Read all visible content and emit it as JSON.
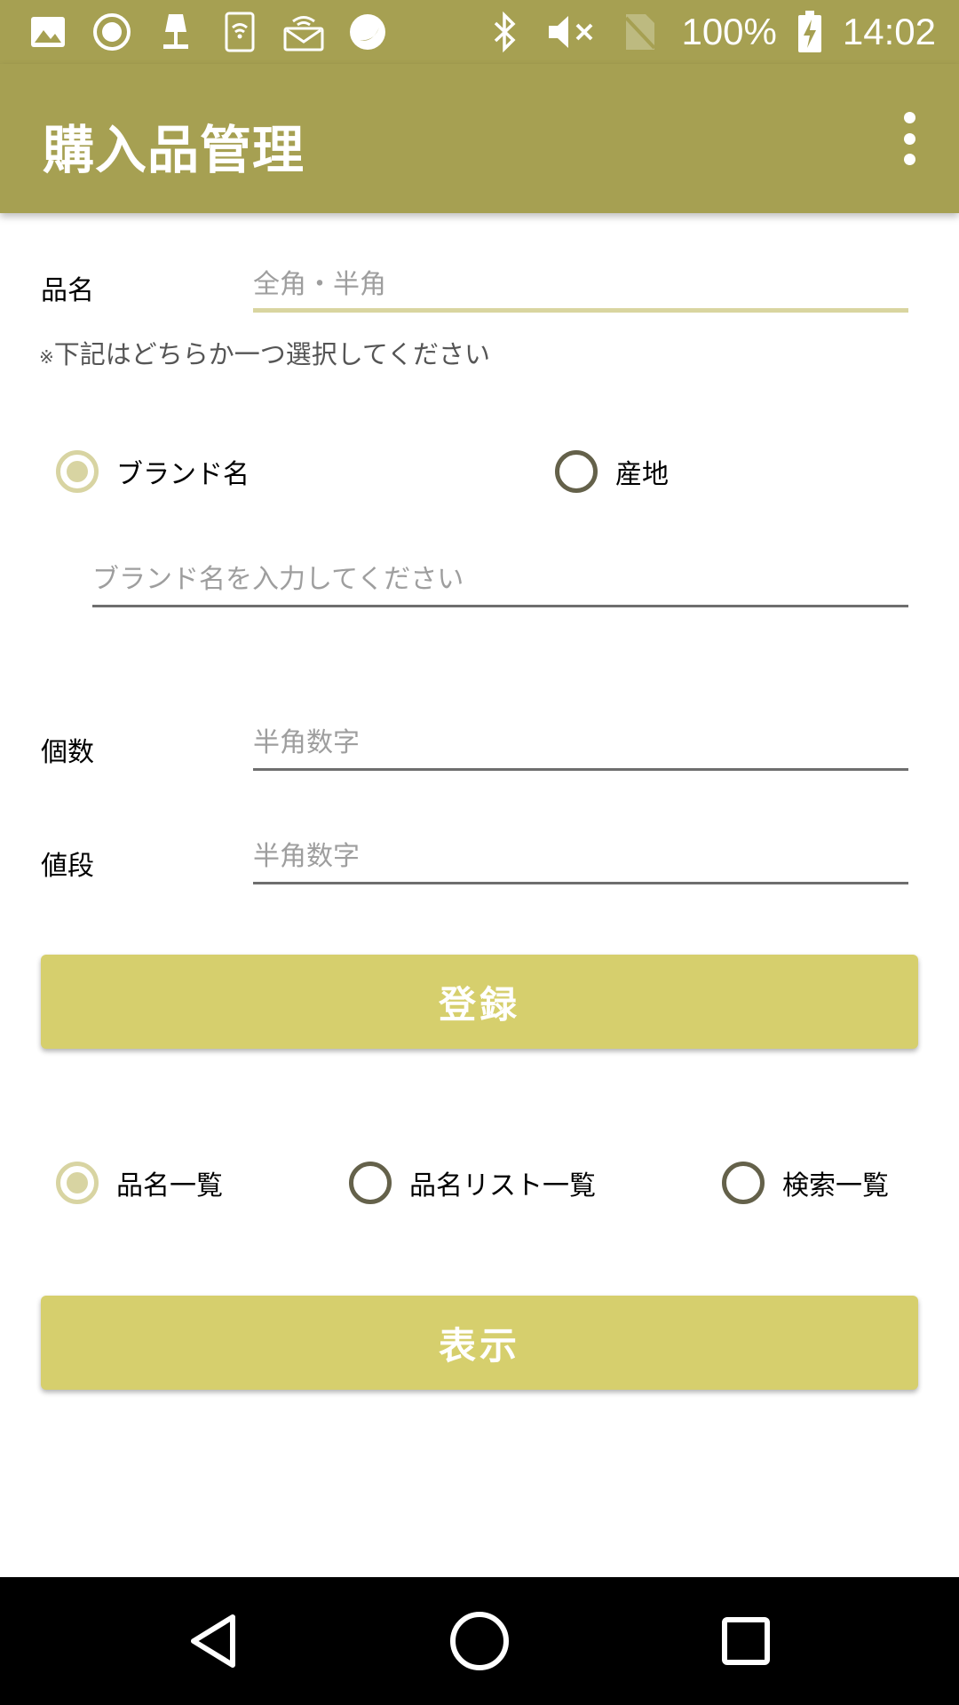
{
  "status_bar": {
    "battery": "100%",
    "time": "14:02",
    "icons": [
      "image-icon",
      "record-icon",
      "lamp-icon",
      "sim-wifi-icon",
      "router-icon",
      "moon-icon",
      "bluetooth-icon",
      "mute-icon",
      "no-sim-icon",
      "battery-charging-icon"
    ]
  },
  "app_bar": {
    "title": "購入品管理",
    "overflow_icon": "more-vertical-icon"
  },
  "form": {
    "item_name": {
      "label": "品名",
      "placeholder": "全角・半角"
    },
    "note": {
      "mark": "※",
      "text": "下記はどちらか一つ選択してください"
    },
    "choice_radios": [
      {
        "label": "ブランド名",
        "checked": true
      },
      {
        "label": "産地",
        "checked": false
      }
    ],
    "brand": {
      "placeholder": "ブランド名を入力してください"
    },
    "quantity": {
      "label": "個数",
      "placeholder": "半角数字"
    },
    "price": {
      "label": "値段",
      "placeholder": "半角数字"
    },
    "register_button": "登録"
  },
  "display_options": {
    "radios": [
      {
        "label": "品名一覧",
        "checked": true
      },
      {
        "label": "品名リスト一覧",
        "checked": false
      },
      {
        "label": "検索一覧",
        "checked": false
      }
    ],
    "show_button": "表示"
  },
  "nav_bar": {
    "icons": [
      "back-icon",
      "home-icon",
      "recents-icon"
    ]
  },
  "colors": {
    "primary": "#a6a052",
    "button": "#d6cf6d",
    "radio_checked": "#d8d4a2",
    "radio_unchecked": "#64614a",
    "text_secondary": "#555555",
    "hint": "#9e9e9e"
  }
}
